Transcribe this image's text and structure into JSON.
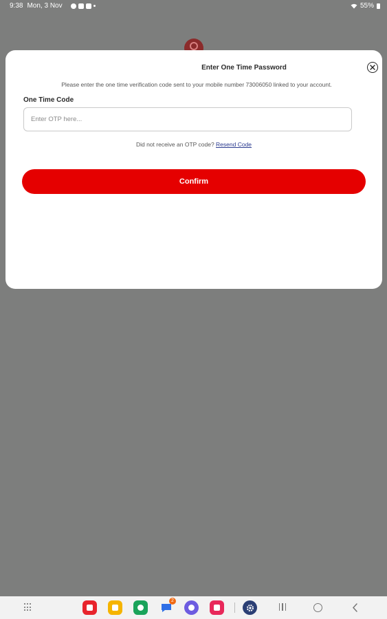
{
  "status_bar": {
    "time": "9:38",
    "date": "Mon, 3 Nov",
    "battery": "55%"
  },
  "modal": {
    "title": "Enter One Time Password",
    "description": "Please enter the one time verification code sent to your mobile number 73006050 linked to your account.",
    "field_label": "One Time Code",
    "input_value": "",
    "input_placeholder": "Enter OTP here...",
    "resend_prompt": "Did not receive an OTP code? ",
    "resend_link": "Resend Code",
    "confirm_label": "Confirm"
  },
  "dock": {
    "apps": [
      {
        "name": "notes-app-icon",
        "color": "#e8242c"
      },
      {
        "name": "folder-app-icon",
        "color": "#f5b400"
      },
      {
        "name": "phone-app-icon",
        "color": "#1aa35a"
      },
      {
        "name": "messages-app-icon",
        "color": "#2f6fe6",
        "badge": "2"
      },
      {
        "name": "chat-app-icon",
        "color": "#6d5ce0"
      },
      {
        "name": "gallery-app-icon",
        "color": "#e8285a"
      },
      {
        "name": "settings-app-icon",
        "color": "#2b3f74"
      }
    ]
  },
  "colors": {
    "accent": "#e50000",
    "overlay": "#7d7e7d",
    "link": "#2a3a8f"
  }
}
